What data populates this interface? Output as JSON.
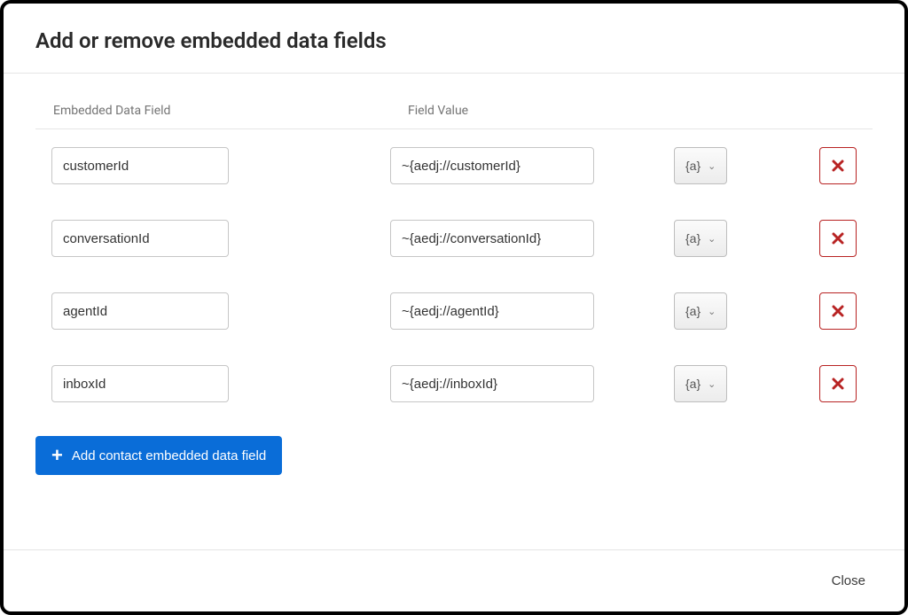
{
  "modal": {
    "title": "Add or remove embedded data fields",
    "columns": {
      "field_name": "Embedded Data Field",
      "field_value": "Field Value"
    },
    "rows": [
      {
        "name": "customerId",
        "value": "~{aedj://customerId}"
      },
      {
        "name": "conversationId",
        "value": "~{aedj://conversationId}"
      },
      {
        "name": "agentId",
        "value": "~{aedj://agentId}"
      },
      {
        "name": "inboxId",
        "value": "~{aedj://inboxId}"
      }
    ],
    "token_button_label": "{a}",
    "add_button_label": "Add contact embedded data field",
    "close_label": "Close"
  }
}
